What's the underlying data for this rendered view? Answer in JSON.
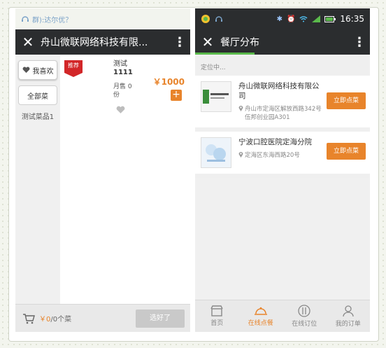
{
  "left_phone": {
    "status_text": "群):达尔优？",
    "title": "舟山微联网络科技有限...",
    "categories": {
      "favorite_label": "我喜欢",
      "all_label": "全部菜",
      "test_label": "测试菜品1"
    },
    "dish": {
      "badge": "推荐",
      "name_line1": "测试",
      "name_line2": "1111",
      "sales_line1": "月售 0",
      "sales_line2": "份",
      "price": "￥1000",
      "add": "+"
    },
    "cart": {
      "amount": "￥0",
      "count": "/0个菜",
      "done_label": "选好了"
    }
  },
  "right_phone": {
    "status": {
      "time": "16:35"
    },
    "title": "餐厅分布",
    "locating_text": "定位中...",
    "restaurants": [
      {
        "name": "舟山微联网络科技有限公司",
        "address": "舟山市定海区解放西路342号伍邦创业园A301",
        "button": "立即点菜"
      },
      {
        "name": "宁波口腔医院定海分院",
        "address": "定海区东海西路20号",
        "button": "立即点菜"
      }
    ],
    "tabs": [
      {
        "label": "首页",
        "icon": "home-icon"
      },
      {
        "label": "在线点餐",
        "icon": "dish-cover-icon"
      },
      {
        "label": "在线订位",
        "icon": "cutlery-icon"
      },
      {
        "label": "我的订单",
        "icon": "user-icon"
      }
    ]
  },
  "colors": {
    "accent": "#e8842b",
    "topbar": "#2b2d2f",
    "badge": "#d22628",
    "underline": "#5ab94b"
  }
}
